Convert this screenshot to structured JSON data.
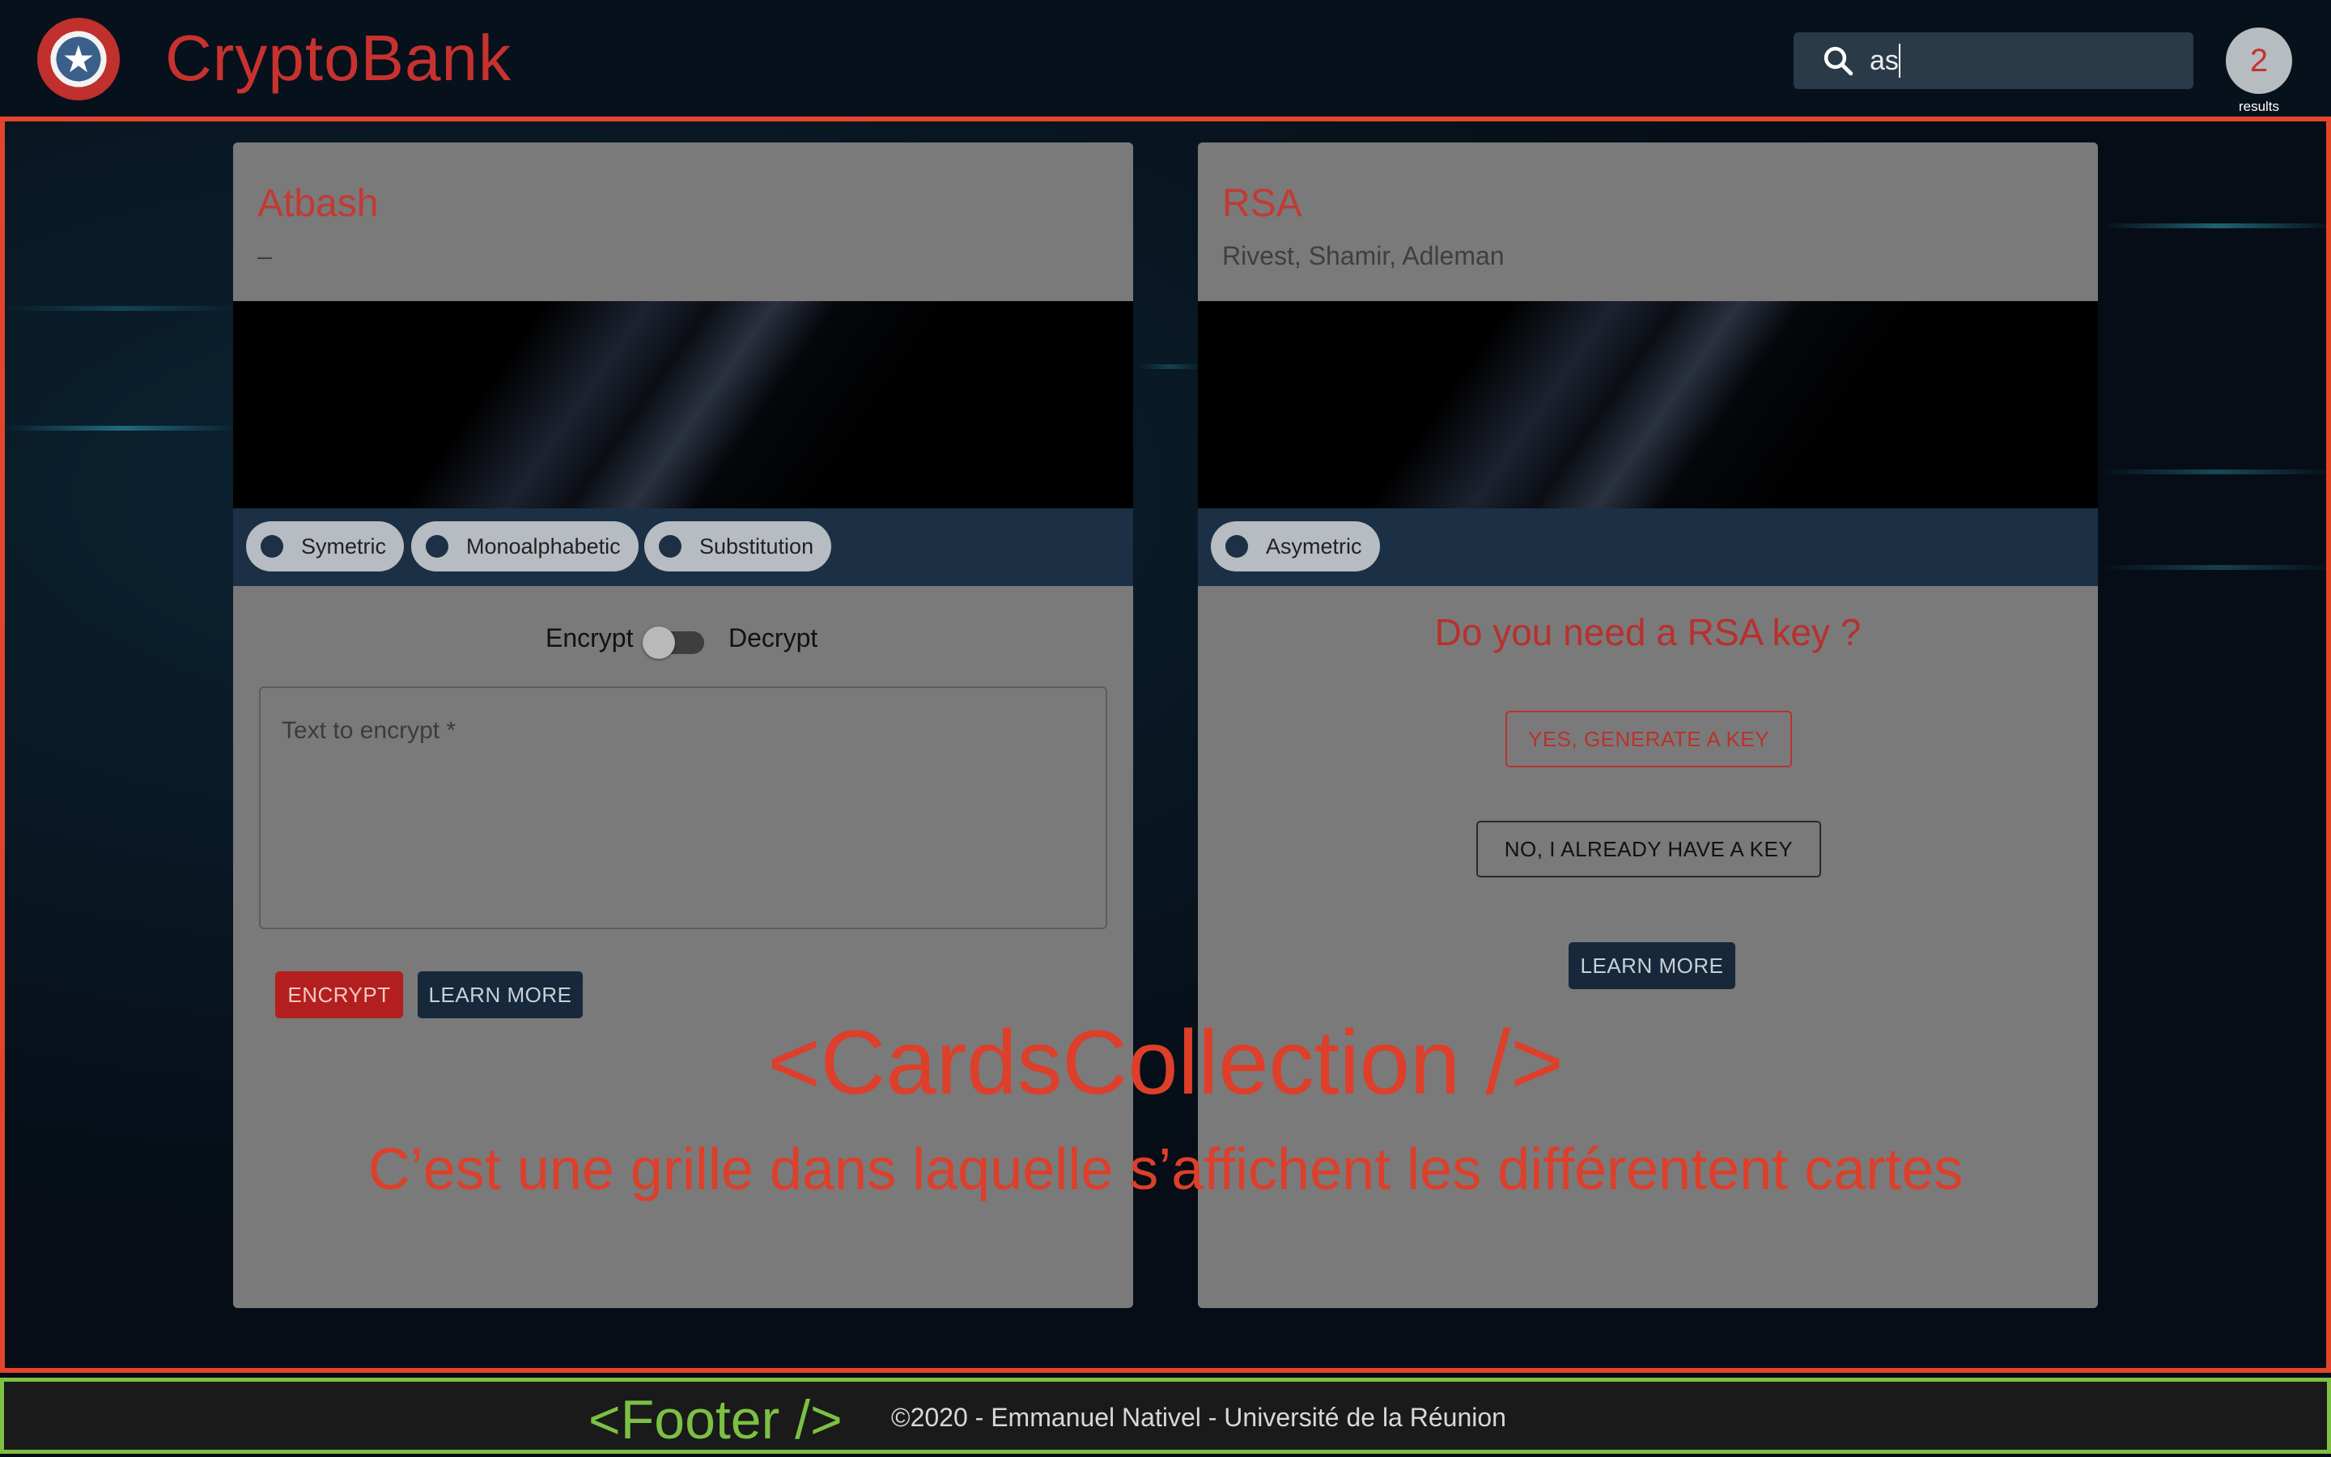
{
  "header": {
    "brand": "CryptoBank",
    "search_value": "as",
    "results_count": "2",
    "results_label": "results"
  },
  "cards": [
    {
      "title": "Atbash",
      "subtitle": "–",
      "chips": [
        "Symetric",
        "Monoalphabetic",
        "Substitution"
      ],
      "toggle_left": "Encrypt",
      "toggle_right": "Decrypt",
      "toggle_on": false,
      "textarea_placeholder": "Text to encrypt *",
      "primary_button": "ENCRYPT",
      "secondary_button": "LEARN MORE"
    },
    {
      "title": "RSA",
      "subtitle": "Rivest, Shamir, Adleman",
      "chips": [
        "Asymetric"
      ],
      "question": "Do you need a RSA key ?",
      "yes_button": "YES, GENERATE A KEY",
      "no_button": "NO, I ALREADY HAVE A KEY",
      "learn_button": "LEARN MORE"
    }
  ],
  "annotations": {
    "main_component": "<CardsCollection />",
    "main_description": "C’est une grille dans laquelle s’affichent les différentent cartes",
    "footer_component": "<Footer />"
  },
  "footer": {
    "text": "©2020 - Emmanuel Nativel - Université de la Réunion"
  },
  "colors": {
    "brand_red": "#c8322e",
    "card_grey": "#7a7a7a",
    "chip_bar": "#1b3045",
    "annotation_red": "#e2452b",
    "annotation_green": "#7cc043"
  }
}
